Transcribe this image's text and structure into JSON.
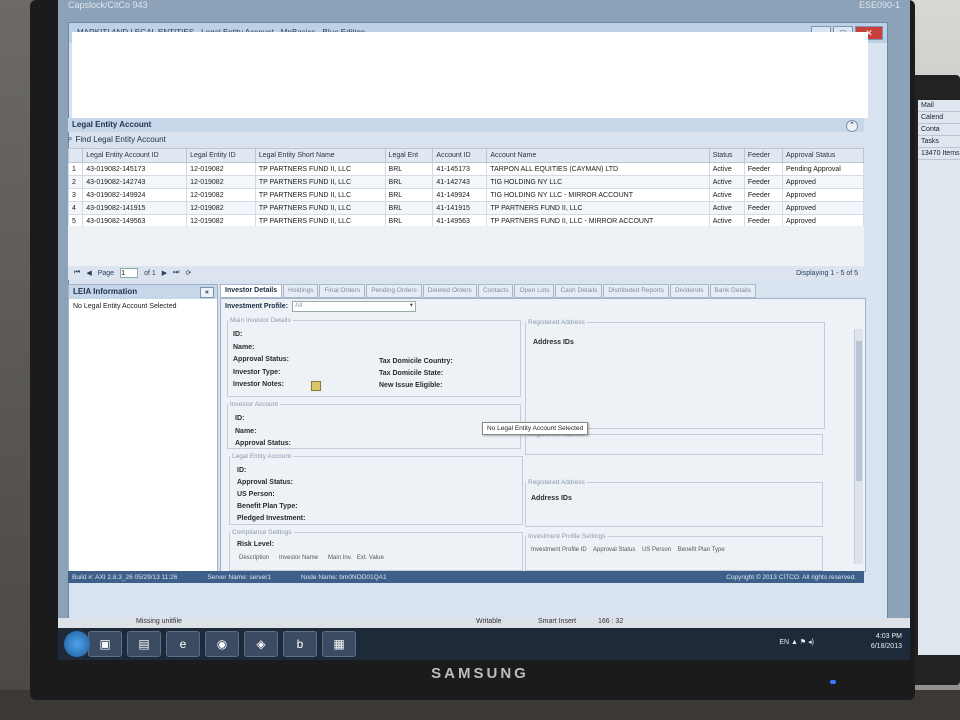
{
  "window": {
    "title": "MARKITI AND LEGAL ENTITIES - Legal Entity Account - MnBasics - Blue Edition"
  },
  "screen_top": {
    "left_text": "Capslock/CitCo 943",
    "right_text": "ESE090-1"
  },
  "lea": {
    "header": "Legal Entity Account",
    "find_label": "Find Legal Entity Account",
    "columns": [
      "Legal Entity Account ID",
      "Legal Entity ID",
      "Legal Entity Short Name",
      "Legal Ent",
      "Account ID",
      "Account Name",
      "Status",
      "Feeder",
      "Approval Status"
    ],
    "rows": [
      {
        "n": "1",
        "lea_id": "43-019082-145173",
        "le_id": "12-019082",
        "short": "TP PARTNERS FUND II, LLC",
        "ent": "BRL",
        "acct": "41-145173",
        "name": "TARPON ALL EQUITIES (CAYMAN) LTD",
        "status": "Active",
        "feeder": "Feeder",
        "approval": "Pending Approval"
      },
      {
        "n": "2",
        "lea_id": "43-019082-142743",
        "le_id": "12-019082",
        "short": "TP PARTNERS FUND II, LLC",
        "ent": "BRL",
        "acct": "41-142743",
        "name": "TIG HOLDING NY LLC",
        "status": "Active",
        "feeder": "Feeder",
        "approval": "Approved"
      },
      {
        "n": "3",
        "lea_id": "43-019082-149924",
        "le_id": "12-019082",
        "short": "TP PARTNERS FUND II, LLC",
        "ent": "BRL",
        "acct": "41-149924",
        "name": "TIG HOLDING NY LLC - MIRROR ACCOUNT",
        "status": "Active",
        "feeder": "Feeder",
        "approval": "Approved"
      },
      {
        "n": "4",
        "lea_id": "43-019082-141915",
        "le_id": "12-019082",
        "short": "TP PARTNERS FUND II, LLC",
        "ent": "BRL",
        "acct": "41-141915",
        "name": "TP PARTNERS FUND II, LLC",
        "status": "Active",
        "feeder": "Feeder",
        "approval": "Approved"
      },
      {
        "n": "5",
        "lea_id": "43-019082-149563",
        "le_id": "12-019082",
        "short": "TP PARTNERS FUND II, LLC",
        "ent": "BRL",
        "acct": "41-149563",
        "name": "TP PARTNERS FUND II, LLC - MIRROR ACCOUNT",
        "status": "Active",
        "feeder": "Feeder",
        "approval": "Approved"
      }
    ]
  },
  "pager": {
    "page_label": "Page",
    "page_value": "1",
    "of_label": "of 1",
    "display": "Displaying 1 - 5 of 5"
  },
  "leia": {
    "header": "LEIA Information",
    "empty": "No Legal Entity Account Selected"
  },
  "tabs": [
    "Investor Details",
    "Holdings",
    "Final Orders",
    "Pending Orders",
    "Deleted Orders",
    "Contacts",
    "Open Lots",
    "Cash Details",
    "Distributed Reports",
    "Dividends",
    "Bank Details"
  ],
  "details": {
    "inv_profile_label": "Investment Profile:",
    "inv_profile_value": "All",
    "main_investor_legend": "Main Investor Details",
    "id": "ID:",
    "name": "Name:",
    "approval_status": "Approval Status:",
    "investor_type": "Investor Type:",
    "investor_notes": "Investor Notes:",
    "tax_country": "Tax Domicile Country:",
    "tax_state": "Tax Domicile State:",
    "new_issue": "New Issue Eligible:",
    "registered_address_legend": "Registered Address",
    "address_ids": "Address IDs",
    "investor_account_legend": "Investor Account",
    "legal_entity_account_legend": "Legal Entity Account",
    "us_person": "US Person:",
    "benefit_plan": "Benefit Plan Type:",
    "pledged": "Pledged Investment:",
    "compliance_legend": "Compliance Settings",
    "risk_level": "Risk Level:",
    "compliance_cols": "Description      Investor Name      Main Inv.   Ext. Value",
    "inv_profile_settings_legend": "Investment Profile Settings",
    "inv_profile_cols": "Investment Profile ID    Approval Status    US Person    Benefit Plan Type"
  },
  "tooltip": "No Legal Entity Account Selected",
  "statusbar": {
    "build": "Build #: AXI 2.8.3_26 05/29/13 11:26",
    "server": "Server Name: server1",
    "node": "Node Name: bm0NOD01QA1",
    "copyright": "Copyright © 2013 CITCO. All rights reserved."
  },
  "strip": {
    "left": "Missing unitfile",
    "mid": "Writable",
    "mode": "Smart Insert",
    "pos": "166 : 32"
  },
  "tray": {
    "lang": "EN",
    "time": "4:03 PM",
    "date": "6/18/2013"
  },
  "monitor_brand": "SAMSUNG",
  "second_monitor": [
    "Mail",
    "Calend",
    "Conta",
    "Tasks",
    "13470 Items"
  ]
}
